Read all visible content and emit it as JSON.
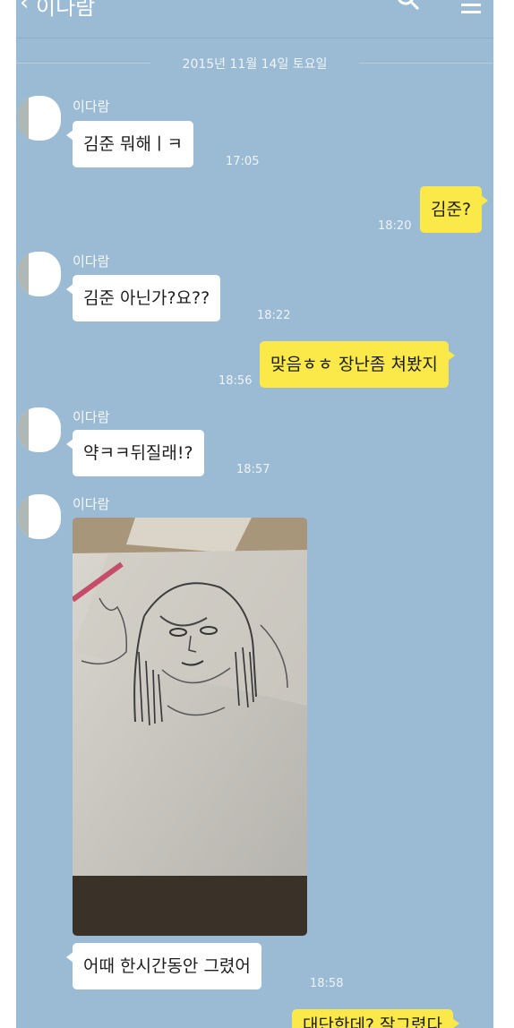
{
  "header": {
    "back_icon": "back-arrow-icon",
    "title": "이다람",
    "search_icon": "search-icon",
    "menu_icon": "menu-icon"
  },
  "date_divider": "2015년 11월 14일 토요일",
  "colors": {
    "background": "#9bbbd4",
    "incoming_bubble": "#ffffff",
    "outgoing_bubble": "#fbe94a"
  },
  "messages": [
    {
      "direction": "in",
      "sender": "이다람",
      "text": "김준 뭐해ㅣㅋ",
      "time": "17:05"
    },
    {
      "direction": "out",
      "text": "김준?",
      "time": "18:20"
    },
    {
      "direction": "in",
      "sender": "이다람",
      "text": "김준 아닌가?요??",
      "time": "18:22"
    },
    {
      "direction": "out",
      "text": "맞음ㅎㅎ 장난좀 쳐봤지",
      "time": "18:56"
    },
    {
      "direction": "in",
      "sender": "이다람",
      "text": "약ㅋㅋ뒤질래!?",
      "time": "18:57"
    },
    {
      "direction": "in",
      "sender": "이다람",
      "type": "image",
      "image": "pencil-sketch-photo"
    },
    {
      "direction": "in",
      "text": "어때 한시간동안 그렸어",
      "time": "18:58"
    },
    {
      "direction": "out",
      "text": "대단한데? 잘그렸다"
    }
  ]
}
